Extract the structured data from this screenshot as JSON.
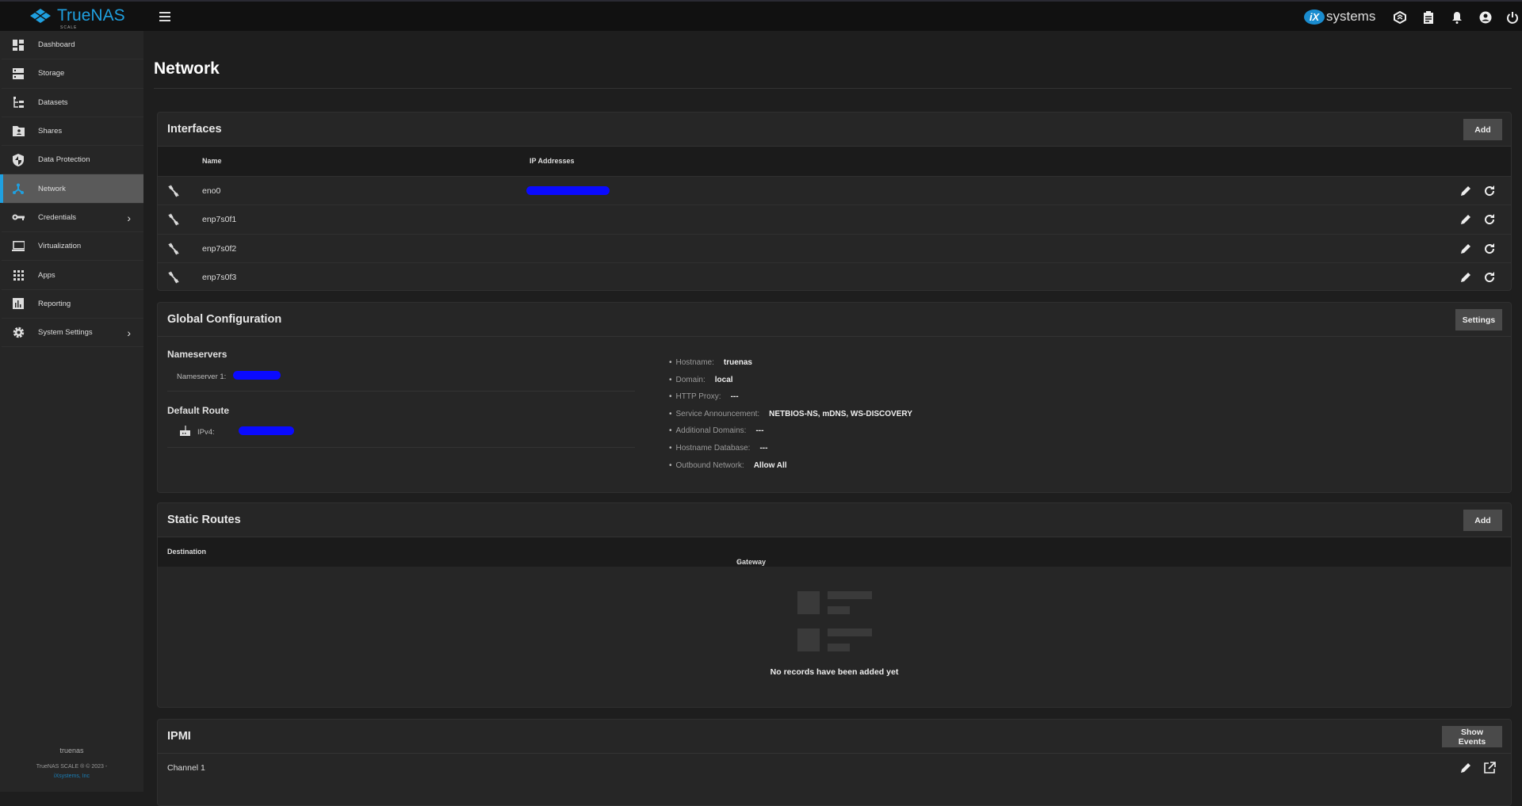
{
  "topbar": {
    "brand": "TrueNAS",
    "brand_sub": "SCALE",
    "vendor_badge": "iX",
    "vendor": "systems",
    "icons": [
      "truecommand-icon",
      "jobs-clipboard-icon",
      "bell-icon",
      "account-circle-icon",
      "power-icon"
    ]
  },
  "sidebar": {
    "items": [
      {
        "label": "Dashboard",
        "icon": "dashboard-icon"
      },
      {
        "label": "Storage",
        "icon": "storage-icon"
      },
      {
        "label": "Datasets",
        "icon": "datasets-icon"
      },
      {
        "label": "Shares",
        "icon": "shares-icon"
      },
      {
        "label": "Data Protection",
        "icon": "shield-icon"
      },
      {
        "label": "Network",
        "icon": "network-icon",
        "active": true
      },
      {
        "label": "Credentials",
        "icon": "key-icon",
        "expandable": true
      },
      {
        "label": "Virtualization",
        "icon": "laptop-icon"
      },
      {
        "label": "Apps",
        "icon": "apps-grid-icon"
      },
      {
        "label": "Reporting",
        "icon": "bar-chart-icon"
      },
      {
        "label": "System Settings",
        "icon": "gear-icon",
        "expandable": true
      }
    ],
    "footer": {
      "hostname": "truenas",
      "copyright": "TrueNAS SCALE ® © 2023 -",
      "company": "iXsystems, Inc"
    }
  },
  "page": {
    "title": "Network"
  },
  "interfaces": {
    "title": "Interfaces",
    "add_label": "Add",
    "columns": [
      "Name",
      "IP Addresses"
    ],
    "rows": [
      {
        "name": "eno0",
        "ip_redacted": true
      },
      {
        "name": "enp7s0f1"
      },
      {
        "name": "enp7s0f2"
      },
      {
        "name": "enp7s0f3"
      }
    ]
  },
  "global_config": {
    "title": "Global Configuration",
    "settings_label": "Settings",
    "nameservers_heading": "Nameservers",
    "nameserver1_label": "Nameserver 1:",
    "default_route_heading": "Default Route",
    "ipv4_label": "IPv4:",
    "details": [
      {
        "key": "Hostname:",
        "value": "truenas"
      },
      {
        "key": "Domain:",
        "value": "local"
      },
      {
        "key": "HTTP Proxy:",
        "value": "---"
      },
      {
        "key": "Service Announcement:",
        "value": "NETBIOS-NS, mDNS, WS-DISCOVERY"
      },
      {
        "key": "Additional Domains:",
        "value": "---"
      },
      {
        "key": "Hostname Database:",
        "value": "---"
      },
      {
        "key": "Outbound Network:",
        "value": "Allow All"
      }
    ]
  },
  "static_routes": {
    "title": "Static Routes",
    "add_label": "Add",
    "columns": [
      "Destination",
      "Gateway"
    ],
    "sort_indicator": "↓",
    "empty_text": "No records have been added yet"
  },
  "ipmi": {
    "title": "IPMI",
    "show_events_label": "Show Events",
    "rows": [
      {
        "name": "Channel 1"
      }
    ]
  }
}
